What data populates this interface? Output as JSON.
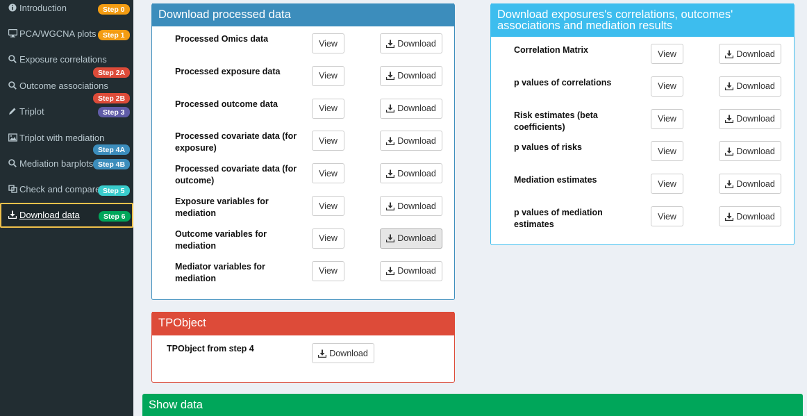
{
  "sidebar": {
    "items": [
      {
        "label": "Introduction",
        "badge": "Step 0",
        "badge_color": "#f39c12"
      },
      {
        "label": "PCA/WGCNA plots",
        "badge": "Step 1",
        "badge_color": "#f39c12"
      },
      {
        "label": "Exposure correlations",
        "badge": "Step 2A",
        "badge_color": "#dd4b39"
      },
      {
        "label": "Outcome associations",
        "badge": "Step 2B",
        "badge_color": "#dd4b39"
      },
      {
        "label": "Triplot",
        "badge": "Step 3",
        "badge_color": "#605ca8"
      },
      {
        "label": "Triplot with mediation",
        "badge": "Step 4A",
        "badge_color": "#3c8dbc"
      },
      {
        "label": "Mediation barplots",
        "badge": "Step 4B",
        "badge_color": "#3c8dbc"
      },
      {
        "label": "Check and compare",
        "badge": "Step 5",
        "badge_color": "#39cccc"
      },
      {
        "label": "Download data",
        "badge": "Step 6",
        "badge_color": "#00a65a"
      }
    ]
  },
  "processed": {
    "title": "Download processed data",
    "header_color": "#3c8dbc",
    "rows": [
      {
        "label": "Processed Omics data",
        "view": "View",
        "download": "Download"
      },
      {
        "label": "Processed exposure data",
        "view": "View",
        "download": "Download"
      },
      {
        "label": "Processed outcome data",
        "view": "View",
        "download": "Download"
      },
      {
        "label": "Processed covariate data (for exposure)",
        "view": "View",
        "download": "Download"
      },
      {
        "label": "Processed covariate data (for outcome)",
        "view": "View",
        "download": "Download"
      },
      {
        "label": "Exposure variables for mediation",
        "view": "View",
        "download": "Download"
      },
      {
        "label": "Outcome variables for mediation",
        "view": "View",
        "download": "Download"
      },
      {
        "label": "Mediator variables for mediation",
        "view": "View",
        "download": "Download"
      }
    ]
  },
  "results": {
    "title": "Download exposures's correlations, outcomes' associations and mediation results",
    "header_color": "#3dbdee",
    "rows": [
      {
        "label": "Correlation Matrix",
        "view": "View",
        "download": "Download"
      },
      {
        "label": "p values of correlations",
        "view": "View",
        "download": "Download"
      },
      {
        "label": "Risk estimates (beta coefficients)",
        "view": "View",
        "download": "Download"
      },
      {
        "label": "p values of risks",
        "view": "View",
        "download": "Download"
      },
      {
        "label": "Mediation estimates",
        "view": "View",
        "download": "Download"
      },
      {
        "label": "p values of mediation estimates",
        "view": "View",
        "download": "Download"
      }
    ]
  },
  "tpobject": {
    "title": "TPObject",
    "header_color": "#dd4b39",
    "row_label": "TPObject from step 4",
    "download": "Download"
  },
  "show_data": {
    "title": "Show data",
    "header_color": "#00a65a"
  }
}
